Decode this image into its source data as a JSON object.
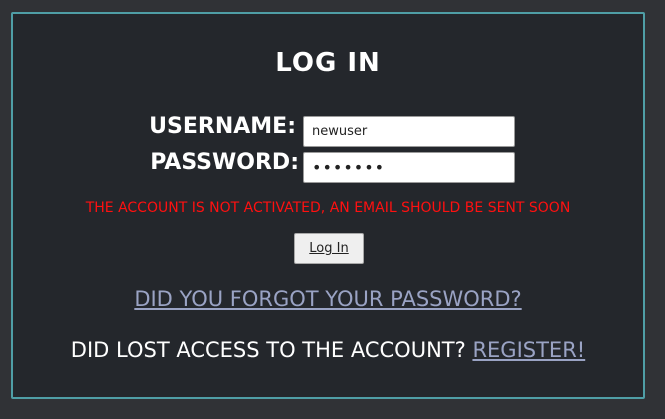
{
  "login": {
    "title": "LOG IN",
    "username_label": "USERNAME:",
    "password_label": "PASSWORD:",
    "username_value": "newuser",
    "password_value": "•••••••",
    "error_message": "THE ACCOUNT IS NOT ACTIVATED, AN EMAIL SHOULD BE SENT SOON",
    "login_button": "Log In",
    "forgot_password_link": "DID YOU FORGOT YOUR PASSWORD?",
    "lost_access_text": "DID LOST ACCESS TO THE ACCOUNT?",
    "register_link": "REGISTER!"
  },
  "colors": {
    "panel_background": "#24272c",
    "panel_border": "#4f9ea6",
    "error": "#ff1010",
    "link": "#9aa3c4"
  }
}
